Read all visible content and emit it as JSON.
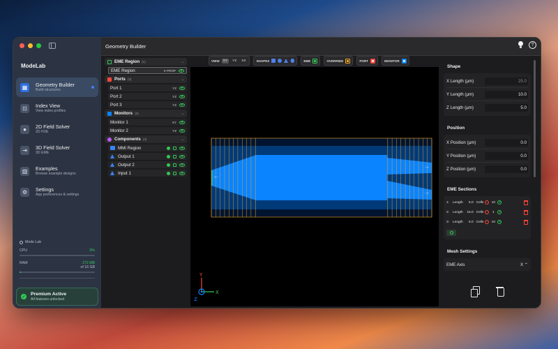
{
  "sidebar": {
    "app_name": "ModeLab",
    "items": [
      {
        "title": "Geometry Builder",
        "subtitle": "Build structures",
        "icon": "grid-icon",
        "glyph": "▦"
      },
      {
        "title": "Index View",
        "subtitle": "View index profiles",
        "icon": "index-icon",
        "glyph": "⊡"
      },
      {
        "title": "2D Field Solver",
        "subtitle": "2D FDE",
        "icon": "circle-icon",
        "glyph": "●"
      },
      {
        "title": "3D Field Solver",
        "subtitle": "3D EME",
        "icon": "eme-icon",
        "glyph": "⇥"
      },
      {
        "title": "Examples",
        "subtitle": "Browse example designs",
        "icon": "chart-icon",
        "glyph": "▥"
      },
      {
        "title": "Settings",
        "subtitle": "App preferences & settings",
        "icon": "gear-icon",
        "glyph": "⚙"
      }
    ],
    "system": {
      "label": "Mode Lab",
      "cpu_label": "CPU",
      "cpu_value": "0%",
      "cpu_fraction": 0.0,
      "ram_label": "RAM",
      "ram_value": "272 MB",
      "ram_total": "of 16 GB",
      "ram_fraction": 0.02
    },
    "premium": {
      "title": "Premium Active",
      "subtitle": "All features unlocked"
    }
  },
  "header": {
    "title": "Geometry Builder"
  },
  "tree": {
    "eme": {
      "label": "EME Region",
      "count": "(1)",
      "items": [
        {
          "label": "EME Region",
          "tag": "X PROP"
        }
      ]
    },
    "ports": {
      "label": "Ports",
      "count": "(3)",
      "items": [
        {
          "label": "Port 1",
          "tag": "YZ"
        },
        {
          "label": "Port 2",
          "tag": "YZ"
        },
        {
          "label": "Port 3",
          "tag": "YZ"
        }
      ]
    },
    "monitors": {
      "label": "Monitors",
      "count": "(2)",
      "items": [
        {
          "label": "Monitor 1",
          "tag": "XY"
        },
        {
          "label": "Monitor 2",
          "tag": "YZ"
        }
      ]
    },
    "components": {
      "label": "Components",
      "count": "(4)",
      "items": [
        {
          "label": "MMI Region",
          "shape": "rect"
        },
        {
          "label": "Output 1",
          "shape": "tri"
        },
        {
          "label": "Output 2",
          "shape": "tri"
        },
        {
          "label": "Input 1",
          "shape": "tri"
        }
      ]
    }
  },
  "toolbar": {
    "view_label": "VIEW",
    "views": [
      "XY",
      "YZ",
      "XZ"
    ],
    "active_view": "XY",
    "shapes_label": "SHAPES",
    "eme_label": "EME",
    "override_label": "OVERRIDE",
    "port_label": "PORT",
    "monitor_label": "MONITOR"
  },
  "canvas": {
    "axes": {
      "x": "X",
      "y": "Y",
      "z": "Z"
    },
    "colors": {
      "waveguide": "#0a84ff",
      "eme_lines": "#f5a623",
      "port": "#2ecc71"
    }
  },
  "props": {
    "shape": {
      "title": "Shape",
      "rows": [
        {
          "label": "X Length (µm)",
          "value": "25.0",
          "dim": true
        },
        {
          "label": "Y Length (µm)",
          "value": "10.0",
          "dim": false
        },
        {
          "label": "Z Length (µm)",
          "value": "5.0",
          "dim": false
        }
      ]
    },
    "position": {
      "title": "Position",
      "rows": [
        {
          "label": "X Position (µm)",
          "value": "0.0"
        },
        {
          "label": "Y Position (µm)",
          "value": "0.0"
        },
        {
          "label": "Z Position (µm)",
          "value": "0.0"
        }
      ]
    },
    "eme_sections": {
      "title": "EME Sections",
      "length_label": "Length",
      "cells_label": "Cells",
      "rows": [
        {
          "index": "1:",
          "length": "5.0",
          "cells": "10"
        },
        {
          "index": "2:",
          "length": "15.0",
          "cells": "1"
        },
        {
          "index": "3:",
          "length": "5.0",
          "cells": "10"
        }
      ]
    },
    "mesh": {
      "title": "Mesh Settings",
      "axis_label": "EME Axis",
      "axis_value": "X ⌃"
    }
  }
}
